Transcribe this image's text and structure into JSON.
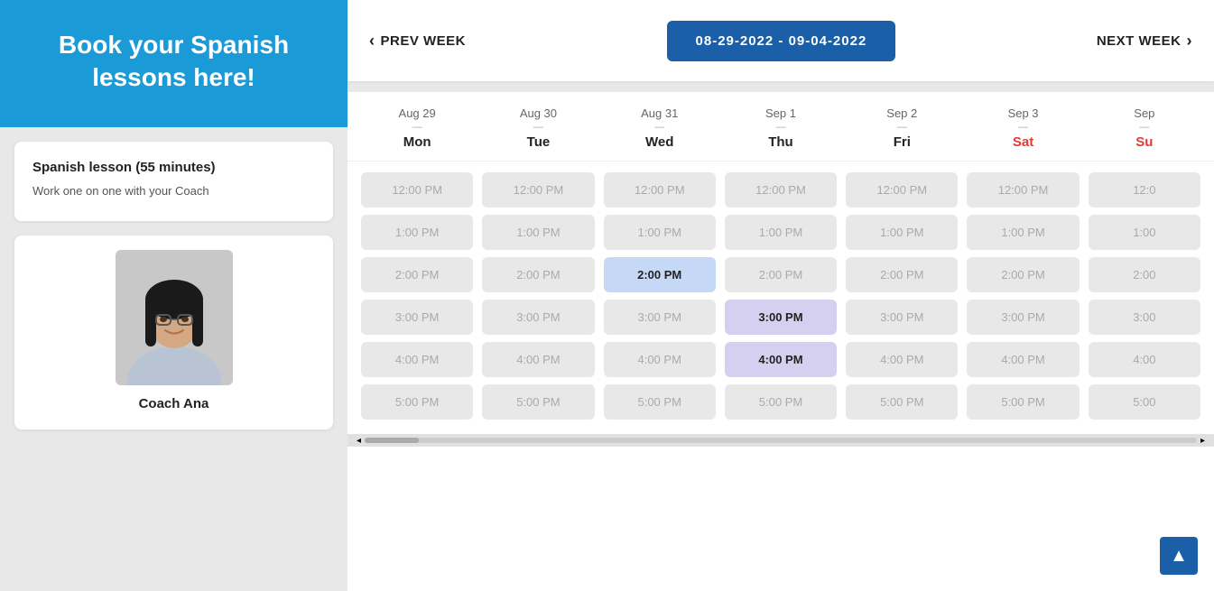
{
  "sidebar": {
    "hero_text": "Book your Spanish lessons here!",
    "hero_bg": "#1a9bd7",
    "lesson_card": {
      "title": "Spanish lesson (55 minutes)",
      "description": "Work one on one with your Coach"
    },
    "coach_card": {
      "name": "Coach Ana"
    }
  },
  "nav": {
    "prev_label": "PREV WEEK",
    "next_label": "NEXT WEEK",
    "date_range": "08-29-2022 - 09-04-2022"
  },
  "calendar": {
    "days": [
      {
        "date": "Aug 29",
        "dash": "—",
        "name": "Mon",
        "weekend": false
      },
      {
        "date": "Aug 30",
        "dash": "—",
        "name": "Tue",
        "weekend": false
      },
      {
        "date": "Aug 31",
        "dash": "—",
        "name": "Wed",
        "weekend": false
      },
      {
        "date": "Sep 1",
        "dash": "—",
        "name": "Thu",
        "weekend": false
      },
      {
        "date": "Sep 2",
        "dash": "—",
        "name": "Fri",
        "weekend": false
      },
      {
        "date": "Sep 3",
        "dash": "—",
        "name": "Sat",
        "weekend": true
      },
      {
        "date": "Sep",
        "dash": "—",
        "name": "Su",
        "weekend": true
      }
    ],
    "time_slots": [
      "12:00 PM",
      "1:00 PM",
      "2:00 PM",
      "3:00 PM",
      "4:00 PM",
      "5:00 PM"
    ],
    "highlights": {
      "wed_2pm": "selected-blue",
      "thu_3pm": "selected-purple",
      "thu_4pm": "selected-purple"
    }
  },
  "scroll_top_icon": "▲"
}
